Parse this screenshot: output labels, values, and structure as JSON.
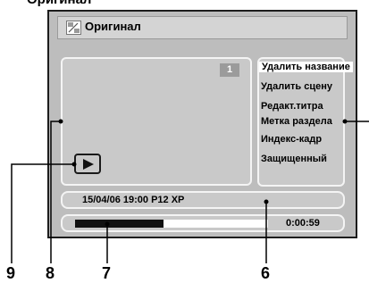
{
  "caption": "Оригинал",
  "title": "Оригинал",
  "title_icon": "original-program-icon",
  "chapter_badge": "1",
  "play_icon": "play-icon",
  "menu": {
    "items": [
      {
        "label": "Удалить название",
        "selected": true
      },
      {
        "label": "Удалить сцену",
        "selected": false
      },
      {
        "label": "Редакт.титра",
        "selected": false
      },
      {
        "label": "Метка раздела",
        "selected": false
      },
      {
        "label": "Индекс-кадр",
        "selected": false
      },
      {
        "label": "Защищенный",
        "selected": false
      }
    ]
  },
  "info": {
    "text": "15/04/06  19:00  P12  XP"
  },
  "progress": {
    "fraction": 0.46,
    "time": "0:00:59"
  },
  "callouts": {
    "c9": "9",
    "c8": "8",
    "c7": "7",
    "c6": "6"
  },
  "colors": {
    "panel": "#bdbdbd",
    "area": "#c9c9c9",
    "badge": "#9b9b9b",
    "progress_fill": "#111111"
  }
}
